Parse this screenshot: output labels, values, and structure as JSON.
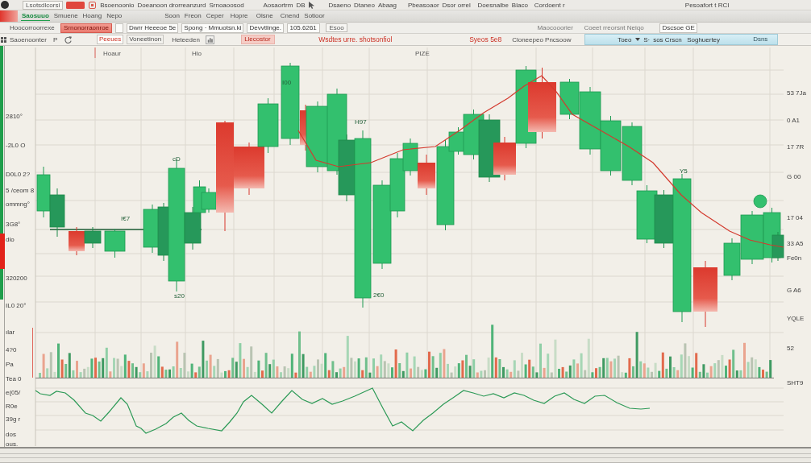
{
  "menu_bar": {
    "items": [
      {
        "kind": "box",
        "label": "Lsotsdlcorsi"
      },
      {
        "kind": "menu",
        "label": "Bsoenoonio"
      },
      {
        "kind": "menu",
        "label": "Doeanoon drorreanzurd"
      },
      {
        "kind": "menu",
        "label": "Srnoaoosod"
      },
      {
        "kind": "menu",
        "label": "Aosaortrm"
      },
      {
        "kind": "menu",
        "label": "DB"
      },
      {
        "kind": "menu",
        "label": "Dsaeno"
      },
      {
        "kind": "menu",
        "label": "Dtaneo"
      },
      {
        "kind": "menu",
        "label": "Abaag"
      },
      {
        "kind": "menu",
        "label": "Pbeasoaor"
      },
      {
        "kind": "menu",
        "label": "Dsor orrel"
      },
      {
        "kind": "menu",
        "label": "Doesnalbe"
      },
      {
        "kind": "menu",
        "label": "Blaco"
      },
      {
        "kind": "menu",
        "label": "Cordoent r"
      },
      {
        "kind": "title",
        "label": "Pesoafort t RCI"
      }
    ]
  },
  "tab_bar": {
    "tabs": [
      {
        "label": "Saosuuo",
        "selected": true
      },
      {
        "label": "Smuene",
        "selected": false
      },
      {
        "label": "Hoang",
        "selected": false
      },
      {
        "label": "Nepo",
        "selected": false
      },
      {
        "label": "Soon",
        "selected": false
      },
      {
        "label": "Freon",
        "selected": false
      },
      {
        "label": "Ceper",
        "selected": false
      },
      {
        "label": "Hopre",
        "selected": false
      },
      {
        "label": "Olsne",
        "selected": false
      },
      {
        "label": "Cnend",
        "selected": false
      },
      {
        "label": "Sotioor",
        "selected": false
      }
    ]
  },
  "field_bar": {
    "items": [
      {
        "kind": "label",
        "label": "Hoocorroorrexe"
      },
      {
        "kind": "alert",
        "label": "Srnonorraonroe"
      },
      {
        "kind": "field",
        "value": "Dwrr Heeeoe 5e"
      },
      {
        "kind": "field",
        "value": "Spong · Mmuotsn.ki"
      },
      {
        "kind": "field",
        "value": "Devvtlinge."
      },
      {
        "kind": "field",
        "value": "105.6261"
      },
      {
        "kind": "box",
        "label": "Esoo"
      },
      {
        "kind": "label",
        "label": "Maocooorier"
      },
      {
        "kind": "label",
        "label": "Coeet rreorsnt Neiqo"
      },
      {
        "kind": "field",
        "value": "Dscsoe GE"
      }
    ]
  },
  "action_bar": {
    "items": [
      {
        "kind": "label",
        "label": "Saoenoonter"
      },
      {
        "kind": "label",
        "label": "P"
      },
      {
        "kind": "seg",
        "label": "Peeues",
        "selected": true
      },
      {
        "kind": "seg",
        "label": "Voneetinon",
        "selected": false
      },
      {
        "kind": "label",
        "label": "Heteeden"
      },
      {
        "kind": "alert",
        "label": "Llecostor"
      },
      {
        "kind": "warn",
        "label": "Wsdtes urre. shotsonfiol"
      },
      {
        "kind": "warn",
        "label": "Syeos 5e8"
      },
      {
        "kind": "label",
        "label": "Cloneepeo Pncsoow"
      }
    ]
  },
  "filter_panel": {
    "items": [
      {
        "kind": "label",
        "label": "Toeo"
      },
      {
        "kind": "label",
        "label": "S·"
      },
      {
        "kind": "label",
        "label": "sos Crscn"
      },
      {
        "kind": "label",
        "label": "Soghuertey"
      },
      {
        "kind": "button",
        "label": "Dsns"
      }
    ]
  },
  "chart": {
    "header": [
      "Hoaur",
      "Hlo",
      "PIZE"
    ],
    "left_axis": [
      "2810°",
      "-2L0 O",
      "D0L0 2?",
      "5 /ceom 8",
      "ommng°",
      "3G8°",
      "dlo",
      "320200",
      "IL0 20°",
      "ılar",
      "4?0",
      "Pa",
      "Tea 0",
      "e(05/",
      "R0e",
      "39g r",
      "dos",
      "ous."
    ],
    "right_axis": [
      "53 7Ja",
      "0 A1",
      "17 7R",
      "G 00",
      "17 04",
      "33 A5",
      "Fe0n",
      "G A6",
      "YQLE",
      "52",
      "SHT9"
    ],
    "annotations": [
      "I00",
      "cD",
      "I€7",
      "s20",
      "2€0",
      "H97",
      "Y5"
    ]
  }
}
